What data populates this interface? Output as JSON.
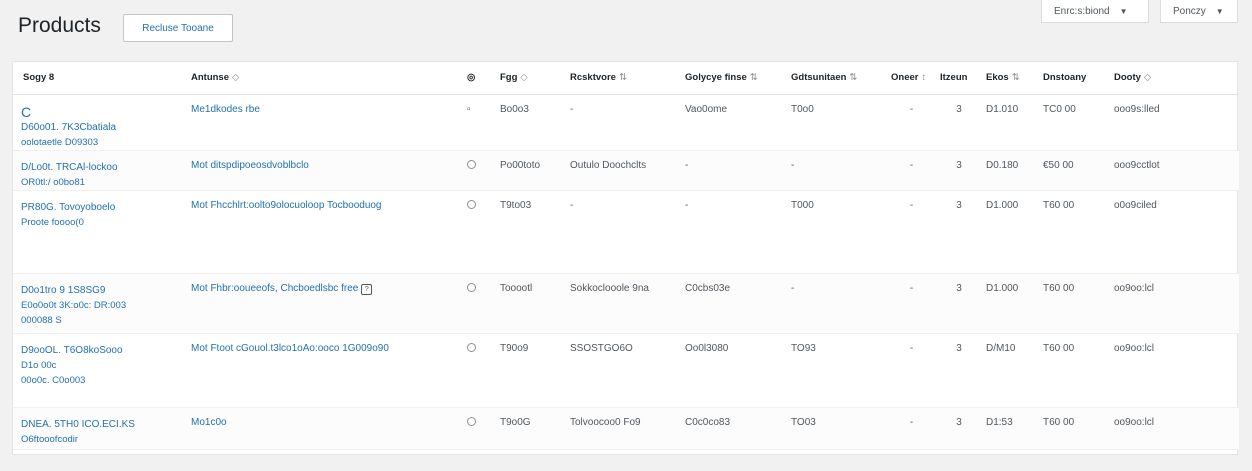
{
  "header": {
    "title": "Products",
    "add_button": "Recluse Tooane"
  },
  "top_buttons": {
    "screen_options": "Enrc:s:biond",
    "help": "Ponczy"
  },
  "columns": {
    "c1": "Sogy",
    "c1_extra": "8",
    "c2": "Antunse",
    "c2_sort": "◇",
    "c3": "◎",
    "c4": "Fgg",
    "c4_sort": "◇",
    "c5": "Rcsktvore",
    "c5_sort": "⇅",
    "c6": "Golycye finse",
    "c6_sort": "⇅",
    "c7": "Gdtsunitaen",
    "c7_sort": "⇅",
    "c8": "Oneer",
    "c8_sort": "↕",
    "c9": "Itzeun",
    "c10": "Ekos",
    "c10_sort": "⇅",
    "c11": "Dnstoany",
    "c12": "Dooty",
    "c12_sort": "◇"
  },
  "rows": [
    {
      "marker": "C",
      "name_lines": [
        "D60o01. 7K3Cbatiala",
        "oolotaetle D09303"
      ],
      "description": "Me1dkodes rbe",
      "sku": "Bo0o3",
      "c5": "-",
      "c6": "Vao0ome",
      "c7": "T0o0",
      "c8": "-",
      "c9": "3",
      "price": "D1.010",
      "total": "TC0 00",
      "status": "ooo9s:lled"
    },
    {
      "marker": "",
      "name_lines": [
        "D/Lo0t. TRCAl-lockoo",
        "OR0tl:/ o0bo81"
      ],
      "description": "Mot ditspdipoeosdvoblbclo",
      "sku": "Po00toto",
      "c5": "Outulo Doochclts",
      "c6": "-",
      "c7": "-",
      "c8": "-",
      "c9": "3",
      "price": "D0.180",
      "total": "€50 00",
      "status": "ooo9cctlot"
    },
    {
      "marker": "",
      "name_lines": [
        "PR80G. Tovoyoboelo",
        "Proote foooo(0"
      ],
      "description": "Mot Fhcchlrt:oolto9olocuoloop Tocbooduog",
      "sku": "T9to03",
      "c5": "-",
      "c6": "-",
      "c7": "T000",
      "c8": "-",
      "c9": "3",
      "price": "D1.000",
      "total": "T60 00",
      "status": "o0o9ciled"
    },
    {
      "marker": "",
      "name_lines": [
        "D0o1tro 9 1S8SG9",
        "E0o0o0t 3K:o0c: DR:003",
        "000088 S"
      ],
      "description": "Mot Fhbr:ooueeofs, Chcboedlsbc free",
      "sku": "Tooootl",
      "c5": "Sokkoclooole 9na",
      "c6": "C0cbs03e",
      "c7": "-",
      "c8": "-",
      "c9": "3",
      "price": "D1.000",
      "total": "T60 00",
      "status": "oo9oo:lcl"
    },
    {
      "marker": "",
      "name_lines": [
        "D9ooOL. T6O8koSooo",
        "D1o 00c",
        "00o0c. C0o003"
      ],
      "description": "Mot Ftoot cGouol.t3lco1oAo:ooco 1G009o90",
      "sku": "T90o9",
      "c5": "SSOSTGO6O",
      "c6": "Oo0l3080",
      "c7": "TO93",
      "c8": "-",
      "c9": "3",
      "price": "D/M10",
      "total": "T60 00",
      "status": "oo9oo:lcl"
    },
    {
      "marker": "",
      "name_lines": [
        "DNEA. 5TH0 ICO.ECI.KS",
        "O6ftooofcodir"
      ],
      "description": "Mo1c0o",
      "sku": "T9o0G",
      "c5": "Tolvoocoo0 Fo9",
      "c6": "C0c0co83",
      "c7": "TO03",
      "c8": "-",
      "c9": "3",
      "price": "D1:53",
      "total": "T60 00",
      "status": "oo9oo:lcl"
    }
  ]
}
